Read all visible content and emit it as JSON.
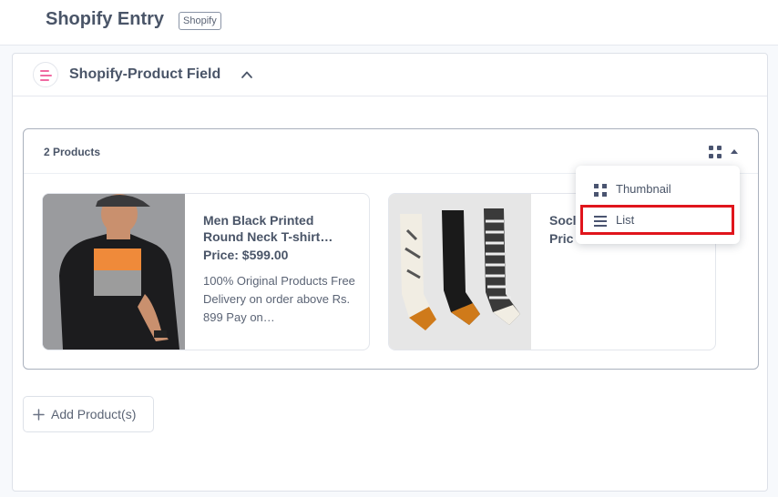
{
  "header": {
    "title": "Shopify Entry",
    "tag": "Shopify"
  },
  "field": {
    "title": "Shopify-Product Field"
  },
  "products": {
    "count_label": "2 Products",
    "items": [
      {
        "name": "Men Black Printed Round Neck T-shirt…",
        "price": "Price: $599.00",
        "description": "100% Original Products Free Delivery on order above Rs. 899 Pay on…"
      },
      {
        "name": "Socl",
        "price": "Pric"
      }
    ]
  },
  "view_menu": {
    "items": [
      {
        "label": "Thumbnail",
        "icon": "grid-icon"
      },
      {
        "label": "List",
        "icon": "list-icon"
      }
    ],
    "highlighted": "List"
  },
  "actions": {
    "add_label": "Add Product(s)"
  },
  "colors": {
    "accent_pink": "#f06aa2",
    "highlight_red": "#e0151c",
    "icon_slate": "#4a5470"
  }
}
